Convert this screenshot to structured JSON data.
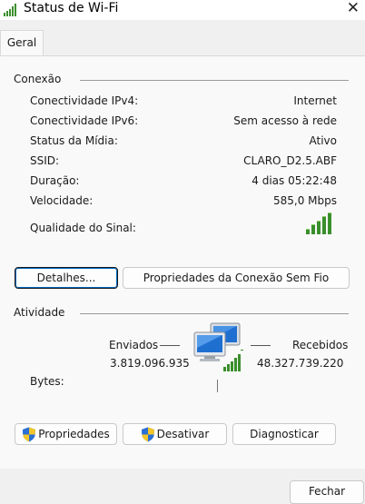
{
  "window": {
    "title": "Status de Wi-Fi",
    "icon": "wifi-signal-icon",
    "close_glyph": "✕"
  },
  "tabs": [
    {
      "label": "Geral",
      "selected": true
    }
  ],
  "connection": {
    "title": "Conexão",
    "rows": [
      {
        "label": "Conectividade IPv4:",
        "value": "Internet"
      },
      {
        "label": "Conectividade IPv6:",
        "value": "Sem acesso à rede"
      },
      {
        "label": "Status da Mídia:",
        "value": "Ativo"
      },
      {
        "label": "SSID:",
        "value": "CLARO_D2.5.ABF"
      },
      {
        "label": "Duração:",
        "value": "4 dias 05:22:48"
      },
      {
        "label": "Velocidade:",
        "value": "585,0 Mbps"
      }
    ],
    "signal_label": "Qualidade do Sinal:",
    "signal_bars": 5,
    "details_button": "Detalhes...",
    "wireless_props_button": "Propriedades da Conexão Sem Fio"
  },
  "activity": {
    "title": "Atividade",
    "sent_label": "Enviados",
    "received_label": "Recebidos",
    "bytes_label": "Bytes:",
    "sent_value": "3.819.096.935",
    "received_value": "48.327.739.220",
    "network_icon": "network-computers-icon"
  },
  "actions": {
    "properties_button": "Propriedades",
    "disable_button": "Desativar",
    "diagnose_button": "Diagnosticar",
    "shield_icon": "uac-shield-icon"
  },
  "footer": {
    "close_button": "Fechar"
  },
  "colors": {
    "signal_green": "#3a8f2c",
    "focus_blue": "#0067c0",
    "monitor_blue": "#1f6fd1"
  }
}
